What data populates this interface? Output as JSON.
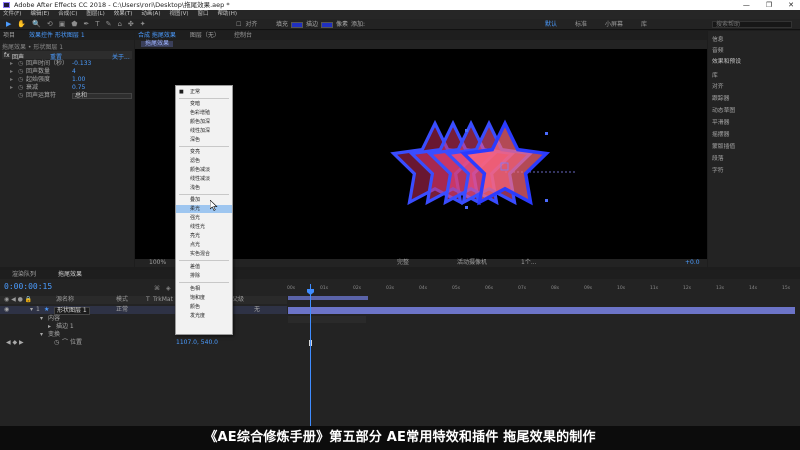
{
  "window": {
    "title": "Adobe After Effects CC 2018 - C:\\Users\\rori\\Desktop\\拖尾效果.aep *",
    "controls": [
      "—",
      "❐",
      "✕"
    ]
  },
  "menu": [
    "文件(F)",
    "编辑(E)",
    "合成(C)",
    "图层(L)",
    "效果(T)",
    "动画(A)",
    "视图(V)",
    "窗口",
    "帮助(H)"
  ],
  "toolbar": {
    "tools": [
      "▶",
      "✋",
      "🔍",
      "⟲",
      "▣",
      "⬟",
      "✒",
      "T",
      "✎",
      "⌂",
      "✤",
      "✦"
    ],
    "snap_label": "对齐",
    "fill_label": "填充",
    "stroke_label": "描边",
    "stroke_width": "像素",
    "add_label": "添加:",
    "workspaces": [
      "默认",
      "标准",
      "小屏幕",
      "库"
    ],
    "active_workspace": "默认",
    "search_placeholder": "搜索帮助",
    "fill_color": "#2030c0"
  },
  "effect_controls": {
    "tabs": [
      "项目",
      "效果控件 形状图层 1"
    ],
    "subtitle": "拖尾效果 • 形状图层 1",
    "effect_name": "回声",
    "reset_label": "重置",
    "about_label": "关于...",
    "params": [
      {
        "name": "回声时间（秒）",
        "value": "-0.133"
      },
      {
        "name": "回声数量",
        "value": "4"
      },
      {
        "name": "起始强度",
        "value": "1.00"
      },
      {
        "name": "衰减",
        "value": "0.75"
      },
      {
        "name": "回声运算符",
        "value": "总和"
      }
    ]
  },
  "composition": {
    "tabs": [
      "合成 拖尾效果",
      "图层（无）",
      "控制台"
    ],
    "active_tab": "合成 拖尾效果",
    "breadcrumb": "拖尾效果",
    "zoom": "100%",
    "resolution": "完整",
    "camera": "活动摄像机",
    "views": "1个...",
    "offset": "+0.0"
  },
  "blend_menu": {
    "items": [
      {
        "label": "正常",
        "checked": true,
        "group": 0
      },
      {
        "label": "变暗",
        "group": 1
      },
      {
        "label": "色彩增殖",
        "group": 1
      },
      {
        "label": "颜色加深",
        "group": 1
      },
      {
        "label": "线性加深",
        "group": 1
      },
      {
        "label": "深色",
        "group": 1
      },
      {
        "label": "变亮",
        "group": 2
      },
      {
        "label": "滤色",
        "group": 2
      },
      {
        "label": "颜色减淡",
        "group": 2
      },
      {
        "label": "线性减淡",
        "group": 2
      },
      {
        "label": "浅色",
        "group": 2
      },
      {
        "label": "叠加",
        "group": 3
      },
      {
        "label": "柔光",
        "group": 3,
        "selected": true
      },
      {
        "label": "强光",
        "group": 3
      },
      {
        "label": "线性光",
        "group": 3
      },
      {
        "label": "亮光",
        "group": 3
      },
      {
        "label": "点光",
        "group": 3
      },
      {
        "label": "实色混合",
        "group": 3
      },
      {
        "label": "差值",
        "group": 4
      },
      {
        "label": "排除",
        "group": 4
      },
      {
        "label": "色相",
        "group": 5
      },
      {
        "label": "饱和度",
        "group": 5
      },
      {
        "label": "颜色",
        "group": 5
      },
      {
        "label": "发光度",
        "group": 5
      }
    ]
  },
  "right_panel": [
    "信息",
    "音频",
    "效果和预设",
    "库",
    "对齐",
    "跟踪器",
    "动态草图",
    "平滑器",
    "摇摆器",
    "蒙版插值",
    "段落",
    "字符"
  ],
  "timeline": {
    "tabs": [
      "渲染队列",
      "拖尾效果"
    ],
    "timecode": "0:00:00:15",
    "columns": [
      "源名称",
      "模式",
      "T",
      "TrkMat",
      "父级"
    ],
    "layer": {
      "index": "1",
      "name": "形状图层 1",
      "mode": "正常",
      "parent": "无"
    },
    "sub_rows": [
      "内容",
      "描边 1",
      "变换"
    ],
    "sub_mode_label": "正常",
    "property": {
      "name": "位置",
      "value": "1107.0, 540.0"
    },
    "ruler_ticks": [
      "00s",
      "01s",
      "02s",
      "03s",
      "04s",
      "05s",
      "06s",
      "07s",
      "08s",
      "09s",
      "10s",
      "11s",
      "12s",
      "13s",
      "14s",
      "15s"
    ]
  },
  "caption": "《AE综合修炼手册》第五部分 AE常用特效和插件 拖尾效果的制作"
}
